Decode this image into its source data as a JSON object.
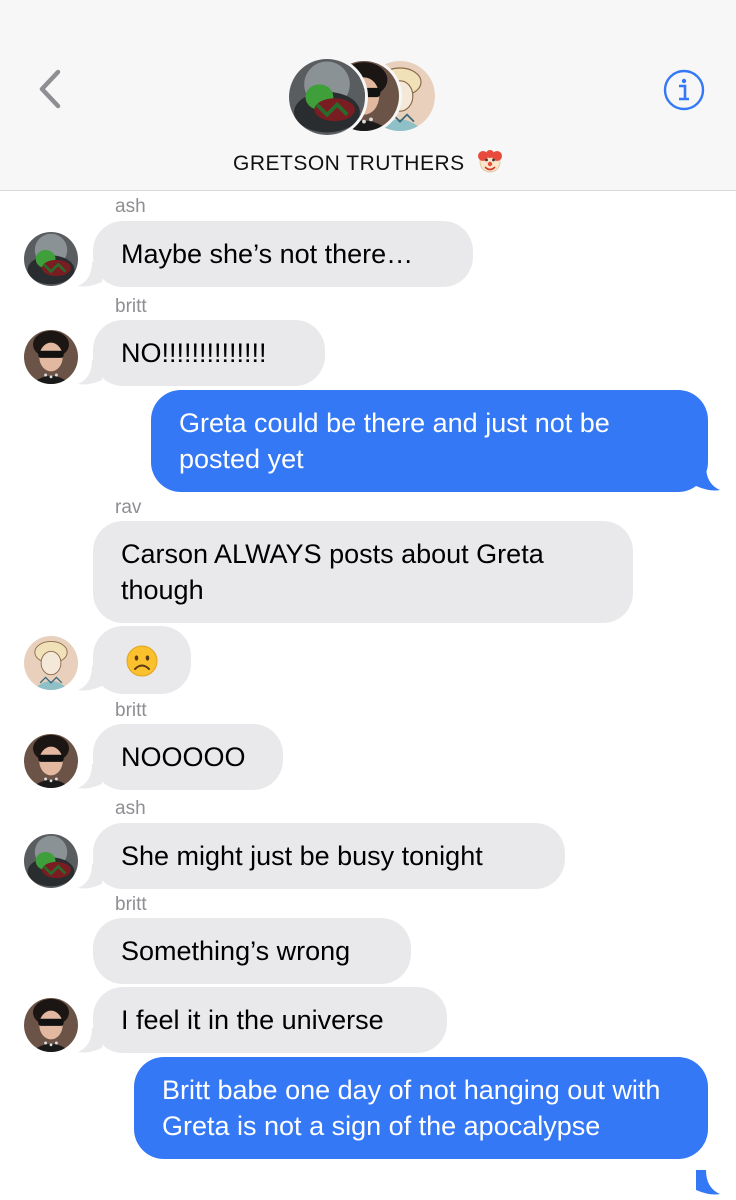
{
  "header": {
    "title": "GRETSON TRUTHERS",
    "title_emoji": "clown-face-emoji"
  },
  "colors": {
    "accent": "#3478f6",
    "incoming_bubble": "#e9e9eb",
    "header_bg": "#f7f7f7",
    "sender_label": "#8e8e93"
  },
  "messages": [
    {
      "sender": "ash",
      "text": "Maybe she’s not there…"
    },
    {
      "sender": "britt",
      "text": "NO!!!!!!!!!!!!!!"
    },
    {
      "sender": "me",
      "text": "Greta could be there and just not be posted yet"
    },
    {
      "sender": "rav",
      "text": "Carson ALWAYS posts about Greta though"
    },
    {
      "sender": "rav",
      "text": "☹️"
    },
    {
      "sender": "britt",
      "text": "NOOOOO"
    },
    {
      "sender": "ash",
      "text": "She might just be busy tonight"
    },
    {
      "sender": "britt",
      "text": "Something’s wrong"
    },
    {
      "sender": "britt",
      "text": "I feel it in the universe"
    },
    {
      "sender": "me",
      "text": "Britt babe one day of not hanging out with Greta is not a sign of the apocalypse"
    }
  ]
}
